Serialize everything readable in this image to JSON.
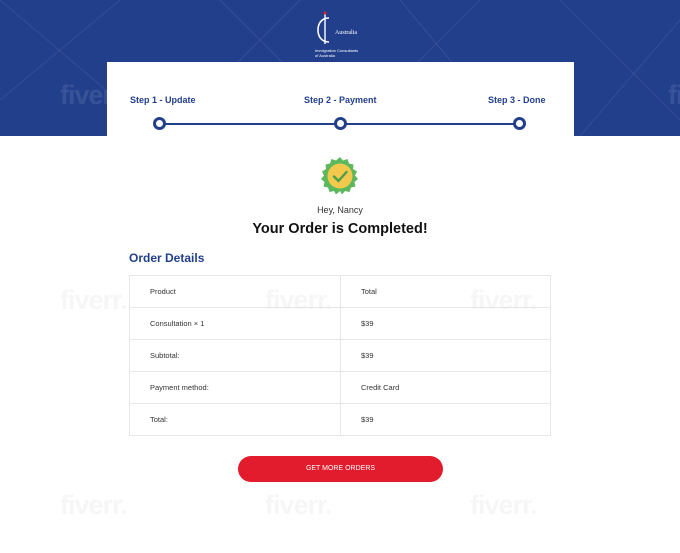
{
  "brand": {
    "name": "Australia",
    "tagline_line1": "Immigration Consultants",
    "tagline_line2": "of Australia"
  },
  "steps": [
    {
      "label": "Step 1 - Update"
    },
    {
      "label": "Step 2 - Payment"
    },
    {
      "label": "Step 3 - Done"
    }
  ],
  "greeting": "Hey, Nancy",
  "headline": "Your Order is Completed!",
  "order": {
    "title": "Order Details",
    "rows": [
      {
        "label": "Product",
        "value": "Total"
      },
      {
        "label": "Consultation × 1",
        "value": "$39"
      },
      {
        "label": "Subtotal:",
        "value": "$39"
      },
      {
        "label": "Payment method:",
        "value": "Credit Card"
      },
      {
        "label": "Total:",
        "value": "$39"
      }
    ]
  },
  "cta_label": "GET MORE ORDERS",
  "watermark": "fiverr.",
  "colors": {
    "primary_blue": "#223f8c",
    "cta_red": "#e21c2c",
    "badge_green": "#5cb85c",
    "badge_yellow": "#f2c94c"
  }
}
